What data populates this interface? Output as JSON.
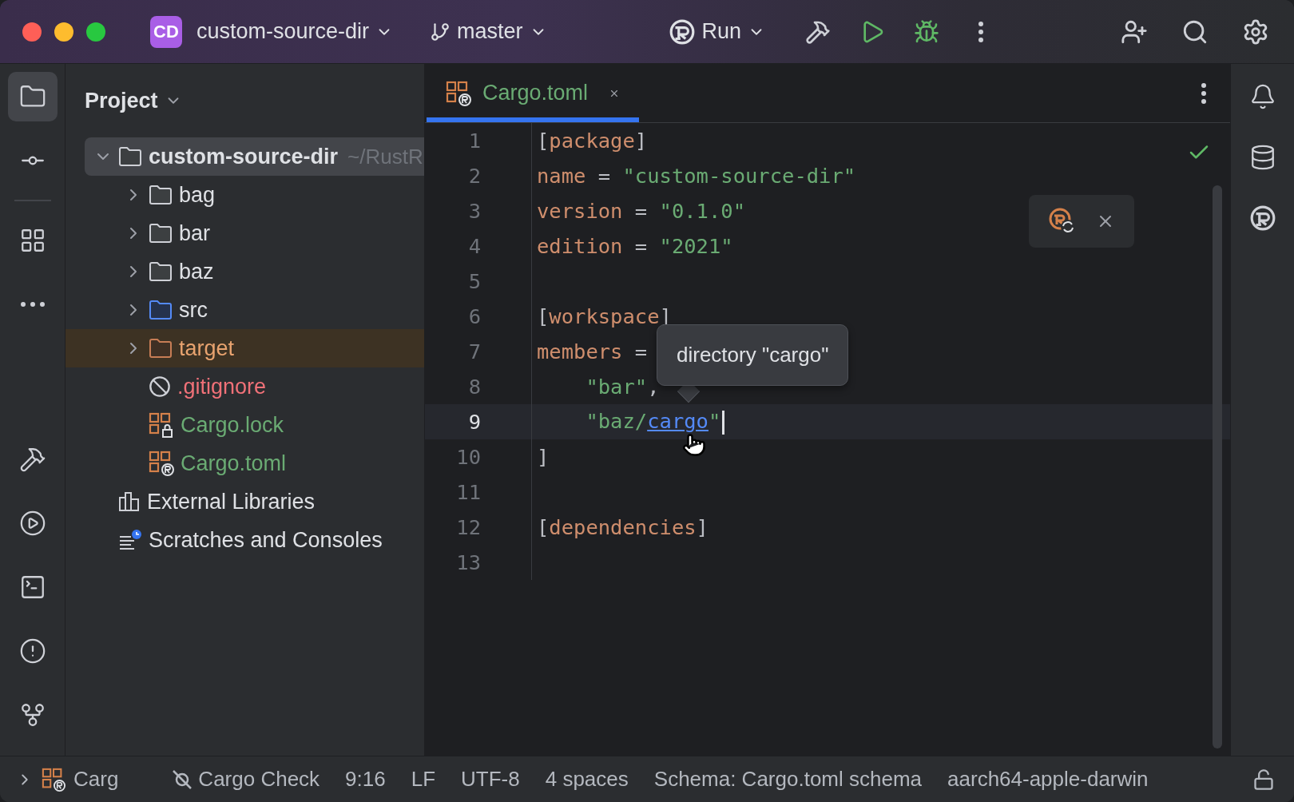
{
  "window": {
    "project_badge": "CD",
    "project": "custom-source-dir",
    "branch": "master",
    "run_config": "Run"
  },
  "left_toolbar": [
    {
      "kind": "project",
      "selected": true
    },
    {
      "kind": "commit",
      "selected": false
    },
    {
      "kind": "structure",
      "selected": false
    },
    {
      "kind": "more",
      "selected": false
    },
    {
      "kind": "build",
      "selected": false
    },
    {
      "kind": "run",
      "selected": false
    },
    {
      "kind": "terminal",
      "selected": false
    },
    {
      "kind": "problems",
      "selected": false
    },
    {
      "kind": "git",
      "selected": false
    }
  ],
  "project_panel": {
    "title": "Project",
    "tree": [
      {
        "label": "custom-source-dir",
        "hint": "~/RustR",
        "kind": "folder",
        "expanded": true,
        "selected": true,
        "children": [
          {
            "label": "bag",
            "kind": "folder",
            "expanded": false,
            "selected": false
          },
          {
            "label": "bar",
            "kind": "folder",
            "expanded": false,
            "selected": false
          },
          {
            "label": "baz",
            "kind": "folder",
            "expanded": false,
            "selected": false
          },
          {
            "label": "src",
            "kind": "source_folder",
            "expanded": false,
            "selected": false
          },
          {
            "label": "target",
            "kind": "excluded_folder",
            "expanded": false,
            "selected": false
          },
          {
            "label": ".gitignore",
            "kind": "ignore_file",
            "selected": false
          },
          {
            "label": "Cargo.lock",
            "kind": "cargo_lock",
            "selected": false
          },
          {
            "label": "Cargo.toml",
            "kind": "cargo_toml",
            "selected": false
          }
        ]
      },
      {
        "label": "External Libraries",
        "kind": "libraries",
        "selected": false
      },
      {
        "label": "Scratches and Consoles",
        "kind": "scratches",
        "selected": false
      }
    ]
  },
  "tabs": [
    {
      "label": "Cargo.toml",
      "selected": true
    }
  ],
  "editor": {
    "lines": [
      {
        "number": "1",
        "current": false,
        "tokens": [
          {
            "kind": "punct",
            "text": "["
          },
          {
            "kind": "key",
            "text": "package"
          },
          {
            "kind": "punct",
            "text": "]"
          }
        ]
      },
      {
        "number": "2",
        "current": false,
        "tokens": [
          {
            "kind": "key",
            "text": "name"
          },
          {
            "kind": "punct",
            "text": " = "
          },
          {
            "kind": "string",
            "text": "\"custom-source-dir\""
          }
        ]
      },
      {
        "number": "3",
        "current": false,
        "tokens": [
          {
            "kind": "key",
            "text": "version"
          },
          {
            "kind": "punct",
            "text": " = "
          },
          {
            "kind": "string",
            "text": "\"0.1.0\""
          }
        ]
      },
      {
        "number": "4",
        "current": false,
        "tokens": [
          {
            "kind": "key",
            "text": "edition"
          },
          {
            "kind": "punct",
            "text": " = "
          },
          {
            "kind": "string",
            "text": "\"2021\""
          }
        ]
      },
      {
        "number": "5",
        "current": false
      },
      {
        "number": "6",
        "current": false,
        "tokens": [
          {
            "kind": "punct",
            "text": "["
          },
          {
            "kind": "key",
            "text": "workspace"
          },
          {
            "kind": "punct",
            "text": "]"
          }
        ]
      },
      {
        "number": "7",
        "current": false,
        "tokens": [
          {
            "kind": "key",
            "text": "members"
          },
          {
            "kind": "punct",
            "text": " ="
          }
        ]
      },
      {
        "number": "8",
        "current": false,
        "tokens": [
          {
            "kind": "string",
            "text": "    \"bar\""
          },
          {
            "kind": "punct",
            "text": ","
          }
        ]
      },
      {
        "number": "9",
        "current": true,
        "tokens": [
          {
            "kind": "string",
            "text": "    \"baz/"
          },
          {
            "kind": "link",
            "text": "cargo"
          },
          {
            "kind": "string",
            "text": "\""
          }
        ]
      },
      {
        "number": "10",
        "current": false,
        "tokens": [
          {
            "kind": "punct",
            "text": "]"
          }
        ]
      },
      {
        "number": "11",
        "current": false
      },
      {
        "number": "12",
        "current": false,
        "tokens": [
          {
            "kind": "punct",
            "text": "["
          },
          {
            "kind": "key",
            "text": "dependencies"
          },
          {
            "kind": "punct",
            "text": "]"
          }
        ]
      },
      {
        "number": "13",
        "current": false
      }
    ],
    "tooltip": "directory \"cargo\""
  },
  "status_bar": {
    "breadcrumb": "Carg",
    "items": [
      "Cargo Check",
      "9:16",
      "LF",
      "UTF-8",
      "4 spaces",
      "Schema: Cargo.toml schema",
      "aarch64-apple-darwin"
    ]
  }
}
